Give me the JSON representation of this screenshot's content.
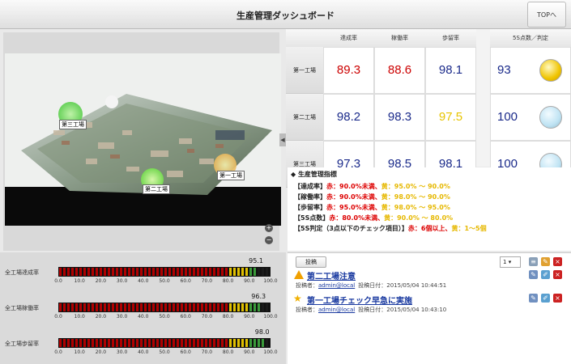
{
  "header": {
    "title": "生産管理ダッシュボード",
    "top_button": "TOPへ"
  },
  "map": {
    "labels": [
      "第三工場",
      "第二工場",
      "第一工場"
    ],
    "zoom_in": "+",
    "zoom_out": "−"
  },
  "table": {
    "headers": [
      "達成率",
      "稼働率",
      "歩留率",
      "5S点数／判定"
    ],
    "rows": [
      {
        "label": "第一工場",
        "values": [
          "89.3",
          "88.6",
          "98.1"
        ],
        "colors": [
          "red",
          "red",
          "blue"
        ],
        "score": "93",
        "lamp": "yellow"
      },
      {
        "label": "第二工場",
        "values": [
          "98.2",
          "98.3",
          "97.5"
        ],
        "colors": [
          "blue",
          "blue",
          "yellow"
        ],
        "score": "100",
        "lamp": "blue"
      },
      {
        "label": "第三工場",
        "values": [
          "97.3",
          "98.5",
          "98.1"
        ],
        "colors": [
          "blue",
          "blue",
          "blue"
        ],
        "score": "100",
        "lamp": "blue"
      }
    ]
  },
  "indicators": {
    "title": "◆ 生産管理指標",
    "lines": [
      {
        "key": "【達成率】",
        "red": "赤：90.0%未満、",
        "yellow": "黄：95.0% ～ 90.0%"
      },
      {
        "key": "【稼働率】",
        "red": "赤：90.0%未満、",
        "yellow": "黄：98.0% ～ 90.0%"
      },
      {
        "key": "【歩留率】",
        "red": "赤：95.0%未満、",
        "yellow": "黄：98.0% ～ 95.0%"
      },
      {
        "key": "【5S点数】",
        "red": "赤：80.0%未満、",
        "yellow": "黄：90.0% ～ 80.0%"
      },
      {
        "key": "【5S判定（3点以下のチェック項目）】",
        "red": "赤：6個以上、",
        "yellow": "黄：1～5個"
      }
    ]
  },
  "gauges": [
    {
      "label": "全工場達成率",
      "value": "95.1",
      "fraction": 0.951
    },
    {
      "label": "全工場稼働率",
      "value": "96.3",
      "fraction": 0.963
    },
    {
      "label": "全工場歩留率",
      "value": "98.0",
      "fraction": 0.98
    }
  ],
  "gauge_ticks": [
    "0.0",
    "10.0",
    "20.0",
    "30.0",
    "40.0",
    "50.0",
    "60.0",
    "70.0",
    "80.0",
    "90.0",
    "100.0"
  ],
  "posts": {
    "post_button": "投稿",
    "page": "1",
    "items": [
      {
        "title": "第二工場注意",
        "author_label": "投稿者：",
        "author": "admin@local",
        "date": "投稿日付：2015/05/04 10:44:51",
        "icon": "warning-icon"
      },
      {
        "title": "第一工場チェック早急に実施",
        "author_label": "投稿者：",
        "author": "admin@local",
        "date": "投稿日付：2015/05/04 10:43:10",
        "icon": "star-icon"
      }
    ]
  },
  "colors": {
    "red": "#cc0000",
    "blue": "#1a2a8a",
    "yellow": "#e8c400"
  }
}
